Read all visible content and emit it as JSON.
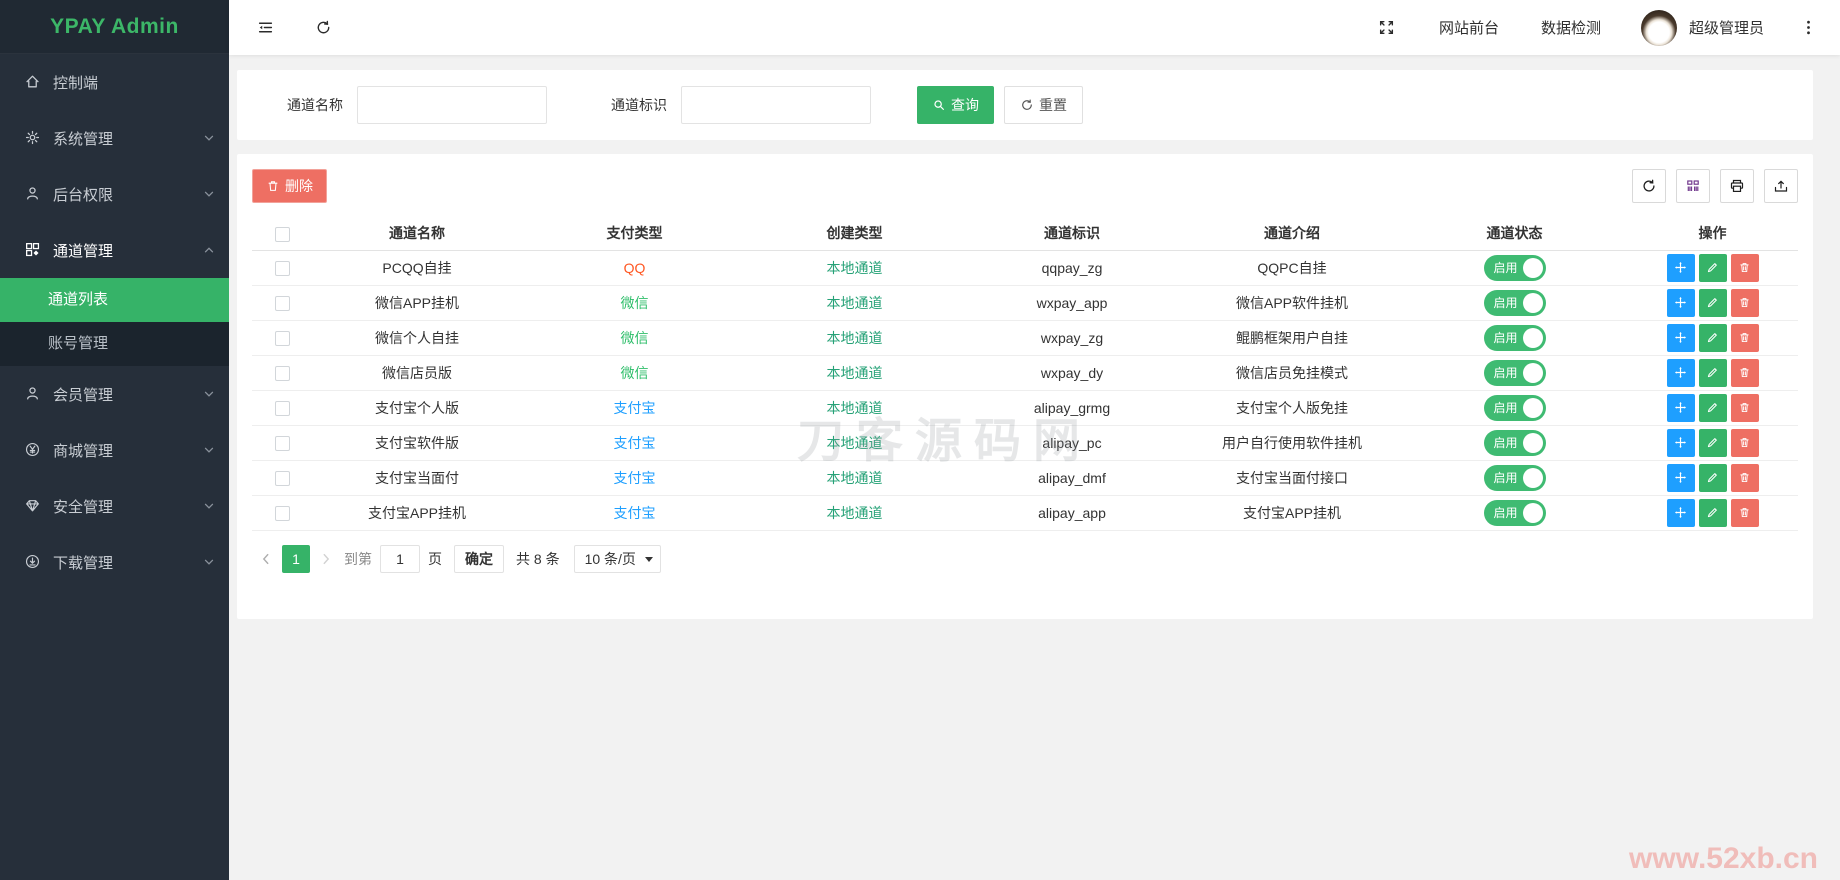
{
  "app": {
    "title": "YPAY Admin",
    "accent_color": "#36b368"
  },
  "sidebar": {
    "items": [
      {
        "id": "console",
        "label": "控制端",
        "icon": "home-icon",
        "expandable": false
      },
      {
        "id": "system",
        "label": "系统管理",
        "icon": "gear-icon",
        "expandable": true
      },
      {
        "id": "auth",
        "label": "后台权限",
        "icon": "user-icon",
        "expandable": true
      },
      {
        "id": "channel",
        "label": "通道管理",
        "icon": "grid-icon",
        "expandable": true,
        "expanded": true,
        "children": [
          {
            "label": "通道列表",
            "active": true
          },
          {
            "label": "账号管理",
            "active": false
          }
        ]
      },
      {
        "id": "member",
        "label": "会员管理",
        "icon": "user-icon",
        "expandable": true
      },
      {
        "id": "mall",
        "label": "商城管理",
        "icon": "yuan-icon",
        "expandable": true
      },
      {
        "id": "security",
        "label": "安全管理",
        "icon": "gem-icon",
        "expandable": true
      },
      {
        "id": "download",
        "label": "下载管理",
        "icon": "download-icon",
        "expandable": true
      }
    ]
  },
  "topbar": {
    "links": [
      "网站前台",
      "数据检测"
    ],
    "username": "超级管理员"
  },
  "search": {
    "fields": [
      {
        "label": "通道名称"
      },
      {
        "label": "通道标识"
      }
    ],
    "query_label": "查询",
    "reset_label": "重置"
  },
  "table": {
    "delete_label": "删除",
    "columns": [
      "通道名称",
      "支付类型",
      "创建类型",
      "通道标识",
      "通道介绍",
      "通道状态",
      "操作"
    ],
    "create_type_color": "#26a277",
    "status_color": "#3fbb72",
    "rows": [
      {
        "name": "PCQQ自挂",
        "pay_type": "QQ",
        "pay_color": "#ff5722",
        "create_type": "本地通道",
        "code": "qqpay_zg",
        "intro": "QQPC自挂",
        "status": "启用"
      },
      {
        "name": "微信APP挂机",
        "pay_type": "微信",
        "pay_color": "#2ebe6a",
        "create_type": "本地通道",
        "code": "wxpay_app",
        "intro": "微信APP软件挂机",
        "status": "启用"
      },
      {
        "name": "微信个人自挂",
        "pay_type": "微信",
        "pay_color": "#2ebe6a",
        "create_type": "本地通道",
        "code": "wxpay_zg",
        "intro": "鲲鹏框架用户自挂",
        "status": "启用"
      },
      {
        "name": "微信店员版",
        "pay_type": "微信",
        "pay_color": "#2ebe6a",
        "create_type": "本地通道",
        "code": "wxpay_dy",
        "intro": "微信店员免挂模式",
        "status": "启用"
      },
      {
        "name": "支付宝个人版",
        "pay_type": "支付宝",
        "pay_color": "#1e9fff",
        "create_type": "本地通道",
        "code": "alipay_grmg",
        "intro": "支付宝个人版免挂",
        "status": "启用"
      },
      {
        "name": "支付宝软件版",
        "pay_type": "支付宝",
        "pay_color": "#1e9fff",
        "create_type": "本地通道",
        "code": "alipay_pc",
        "intro": "用户自行使用软件挂机",
        "status": "启用"
      },
      {
        "name": "支付宝当面付",
        "pay_type": "支付宝",
        "pay_color": "#1e9fff",
        "create_type": "本地通道",
        "code": "alipay_dmf",
        "intro": "支付宝当面付接口",
        "status": "启用"
      },
      {
        "name": "支付宝APP挂机",
        "pay_type": "支付宝",
        "pay_color": "#1e9fff",
        "create_type": "本地通道",
        "code": "alipay_app",
        "intro": "支付宝APP挂机",
        "status": "启用"
      }
    ]
  },
  "pagination": {
    "page": "1",
    "goto_label": "到第",
    "input_value": "1",
    "page_suffix": "页",
    "confirm_label": "确定",
    "total_label": "共 8 条",
    "per_page": "10 条/页"
  },
  "watermark": {
    "center": "刀客源码网",
    "corner": "www.52xb.cn"
  }
}
